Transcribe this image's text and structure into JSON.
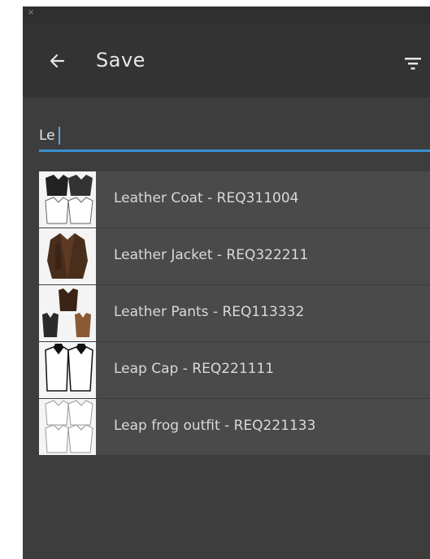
{
  "window": {
    "close_glyph": "×"
  },
  "header": {
    "title": "Save",
    "back_icon": "arrow-left-icon",
    "filter_icon": "filter-icon"
  },
  "search": {
    "value": "Le",
    "placeholder": ""
  },
  "results": [
    {
      "label": "Leather Coat - REQ311004",
      "thumb_icon": "coat-sketch-icon"
    },
    {
      "label": "Leather Jacket - REQ322211",
      "thumb_icon": "jacket-photo-icon"
    },
    {
      "label": "Leather Pants - REQ113332",
      "thumb_icon": "vest-sketch-icon"
    },
    {
      "label": "Leap Cap - REQ221111",
      "thumb_icon": "shirt-sketch-icon"
    },
    {
      "label": "Leap frog outfit - REQ221133",
      "thumb_icon": "outfit-sketch-icon"
    }
  ],
  "colors": {
    "panel": "#3d3d3d",
    "header": "#333333",
    "row": "#4a4a4a",
    "accent": "#3a8fd0"
  }
}
